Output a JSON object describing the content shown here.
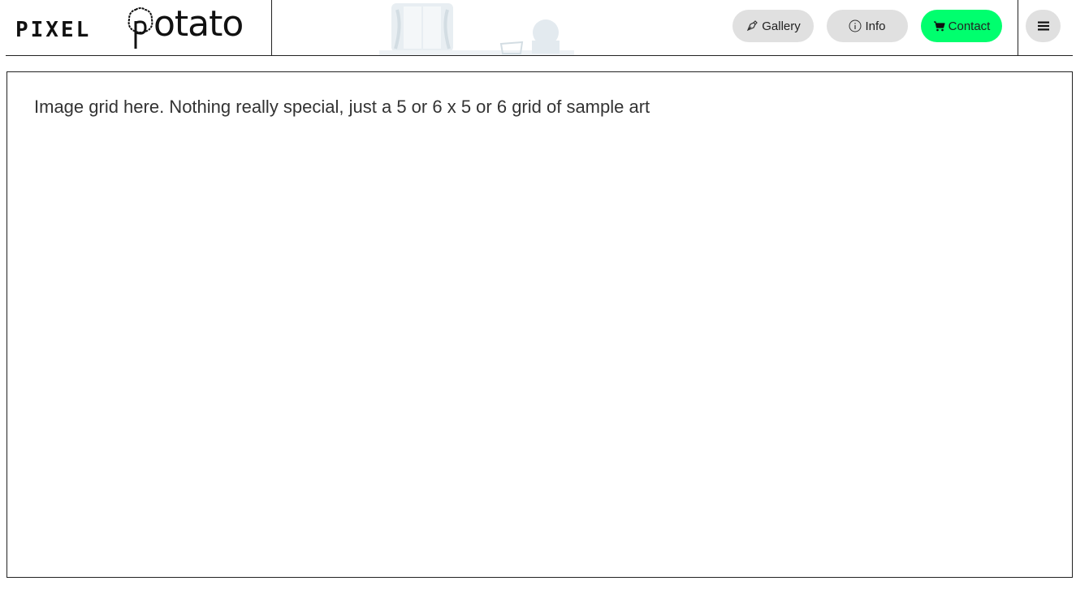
{
  "logo": {
    "part1": "PIXEL",
    "part2": "otato"
  },
  "nav": {
    "gallery_label": "Gallery",
    "gallery_icon": "pen-nib-icon",
    "info_label": "Info",
    "info_icon": "info-circle-icon",
    "contact_label": "Contact",
    "contact_icon": "cart-icon",
    "menu_icon": "hamburger-menu-icon"
  },
  "colors": {
    "contact_bg": "#00ff6e",
    "button_bg": "#e0e0e0"
  },
  "main": {
    "placeholder_text": "Image grid here. Nothing really special, just a 5 or 6 x 5 or 6 grid of sample art"
  }
}
